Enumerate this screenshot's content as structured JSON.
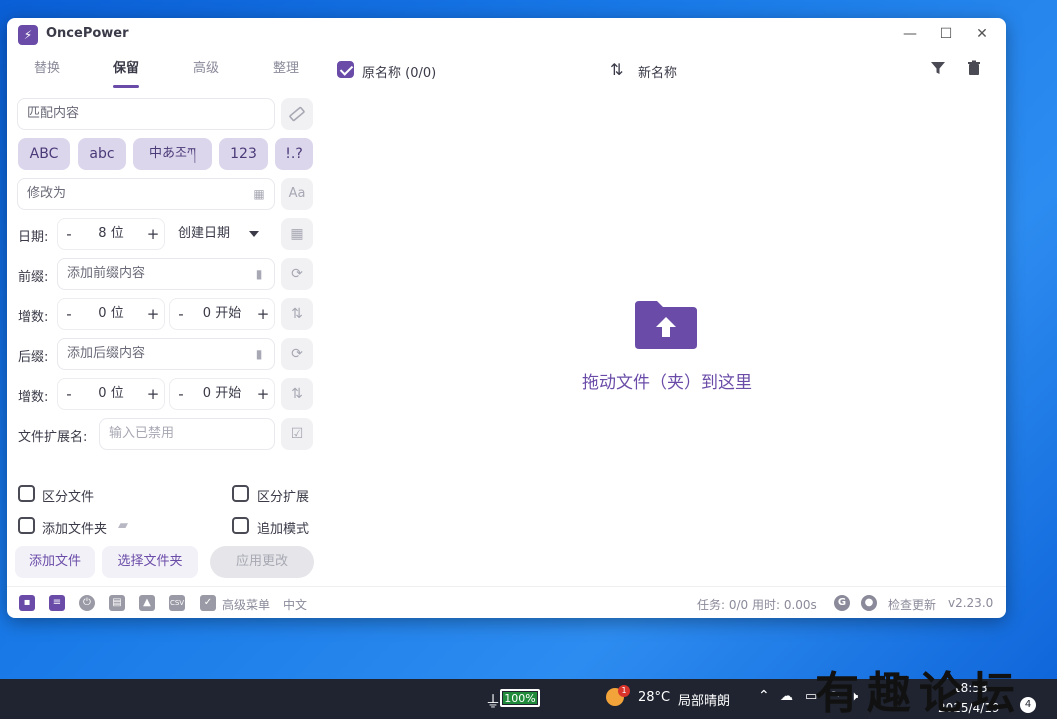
{
  "window": {
    "title": "OncePower",
    "logo_glyph": "⚡",
    "controls": {
      "minimize": "—",
      "maximize": "☐",
      "close": "✕"
    }
  },
  "tabs": [
    {
      "label": "替换"
    },
    {
      "label": "保留",
      "active": true
    },
    {
      "label": "高级"
    },
    {
      "label": "整理"
    }
  ],
  "match": {
    "placeholder": "匹配内容"
  },
  "chips": [
    "ABC",
    "abc",
    "中あ조ཀ",
    "123",
    "!.?"
  ],
  "modify": {
    "placeholder": "修改为"
  },
  "date": {
    "label": "日期:",
    "value": "8 位",
    "dropdown": "创建日期"
  },
  "prefix": {
    "label": "前缀:",
    "placeholder": "添加前缀内容"
  },
  "increment1": {
    "label": "增数:",
    "digits": "0 位",
    "start": "0 开始"
  },
  "suffix": {
    "label": "后缀:",
    "placeholder": "添加后缀内容"
  },
  "increment2": {
    "label": "增数:",
    "digits": "0 位",
    "start": "0 开始"
  },
  "extension": {
    "label": "文件扩展名:",
    "placeholder": "输入已禁用"
  },
  "options": {
    "distinguish_file": "区分文件",
    "distinguish_ext": "区分扩展",
    "add_folder": "添加文件夹",
    "append_mode": "追加模式"
  },
  "actions": {
    "add_file": "添加文件",
    "select_folder": "选择文件夹",
    "apply": "应用更改"
  },
  "list": {
    "original": "原名称 (0/0)",
    "new_name": "新名称"
  },
  "drop": {
    "text": "拖动文件（夹）到这里"
  },
  "statusbar": {
    "advanced_menu": "高级菜单",
    "language": "中文",
    "task": "任务: 0/0 用时: 0.00s",
    "check_update": "检查更新",
    "version": "v2.23.0"
  },
  "taskbar": {
    "battery": "100%",
    "weather_temp": "28°C",
    "weather_desc": "局部晴朗",
    "weather_badge": "1",
    "time": "18:53",
    "date": "2025/4/19",
    "notif_count": "4"
  },
  "watermark": "有趣论坛",
  "colors": {
    "accent": "#6a4ca8",
    "chip_bg": "#dcd6ec",
    "taskbar": "#1f2430"
  }
}
